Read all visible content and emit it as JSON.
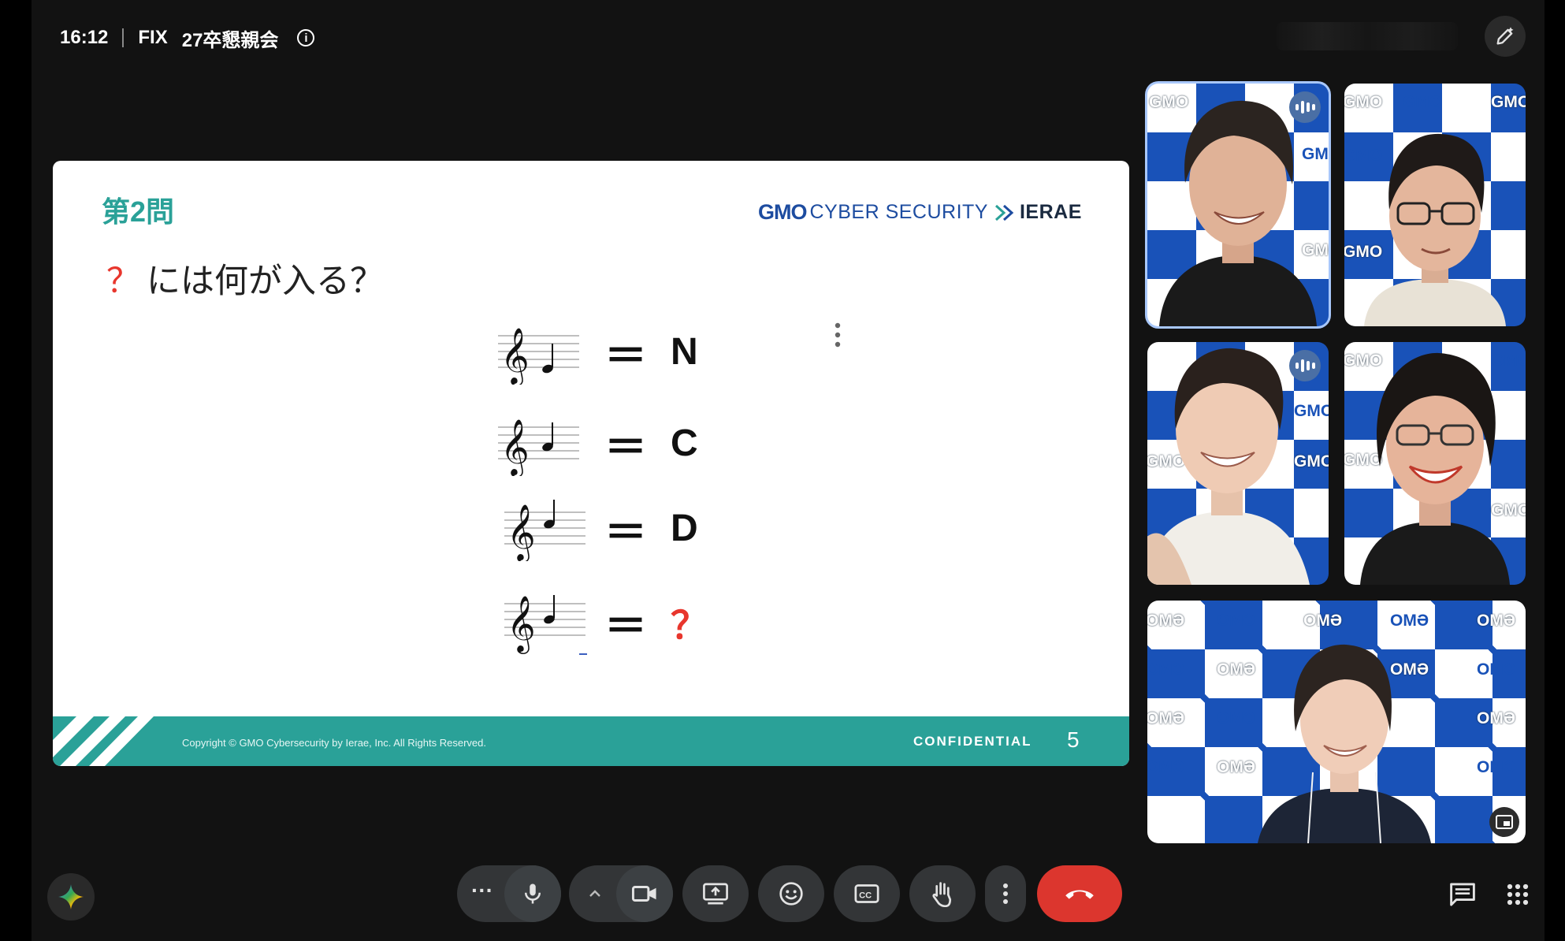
{
  "header": {
    "time": "16:12",
    "group": "FIX",
    "meeting_title": "27卒懇親会",
    "info_icon": "info-icon",
    "pen_icon": "edit-pen-icon"
  },
  "slide": {
    "question_number": "第2問",
    "logo": {
      "gmo": "GMO",
      "cyber": "CYBER SECURITY",
      "ierae": "IERAE"
    },
    "prompt_mark": "？",
    "prompt_text": "には何が入る？",
    "equals": "＝",
    "rows": [
      {
        "answer": "N"
      },
      {
        "answer": "C"
      },
      {
        "answer": "D"
      },
      {
        "answer": "？"
      }
    ],
    "footer": {
      "copyright": "Copyright © GMO Cybersecurity by Ierae, Inc. All Rights Reserved.",
      "confidential": "CONFIDENTIAL",
      "page": "5"
    },
    "accent_color": "#2aa198"
  },
  "tiles": {
    "backdrop_text": "GMO",
    "backdrop_text_mirrored": "OMƏ",
    "brand_color": "#1952b8"
  },
  "controls": {
    "more_dots": "···",
    "colors": {
      "end_call": "#dc362e",
      "button": "#333537"
    }
  }
}
